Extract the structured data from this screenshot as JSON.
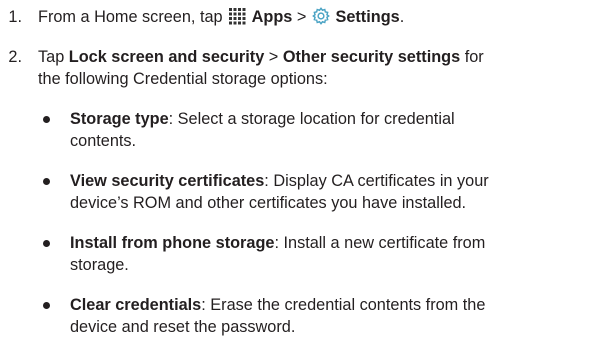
{
  "steps": [
    {
      "number": "1.",
      "prefix": "From a Home screen, tap",
      "apps_icon": "apps-grid-icon",
      "apps_label": "Apps",
      "separator": ">",
      "settings_icon": "settings-gear-icon",
      "settings_label": "Settings",
      "suffix": "."
    },
    {
      "number": "2.",
      "prefix": "Tap",
      "menu1": "Lock screen and security",
      "separator": ">",
      "menu2": "Other security settings",
      "line1_tail": "for",
      "line2": "the following Credential storage options:"
    }
  ],
  "bullets": [
    {
      "title": "Storage type",
      "text_line1": ": Select a storage location for credential",
      "text_line2": "contents."
    },
    {
      "title": "View security certificates",
      "text_line1": ": Display CA certificates in your",
      "text_line2": "device’s ROM and other certificates you have installed."
    },
    {
      "title": "Install from phone storage",
      "text_line1": ": Install a new certificate from",
      "text_line2": "storage."
    },
    {
      "title": "Clear credentials",
      "text_line1": ": Erase the credential contents from the",
      "text_line2": "device and reset the password."
    }
  ],
  "colors": {
    "text": "#231f20",
    "settings_icon": "#4aa3c4",
    "apps_icon": "#333333"
  }
}
